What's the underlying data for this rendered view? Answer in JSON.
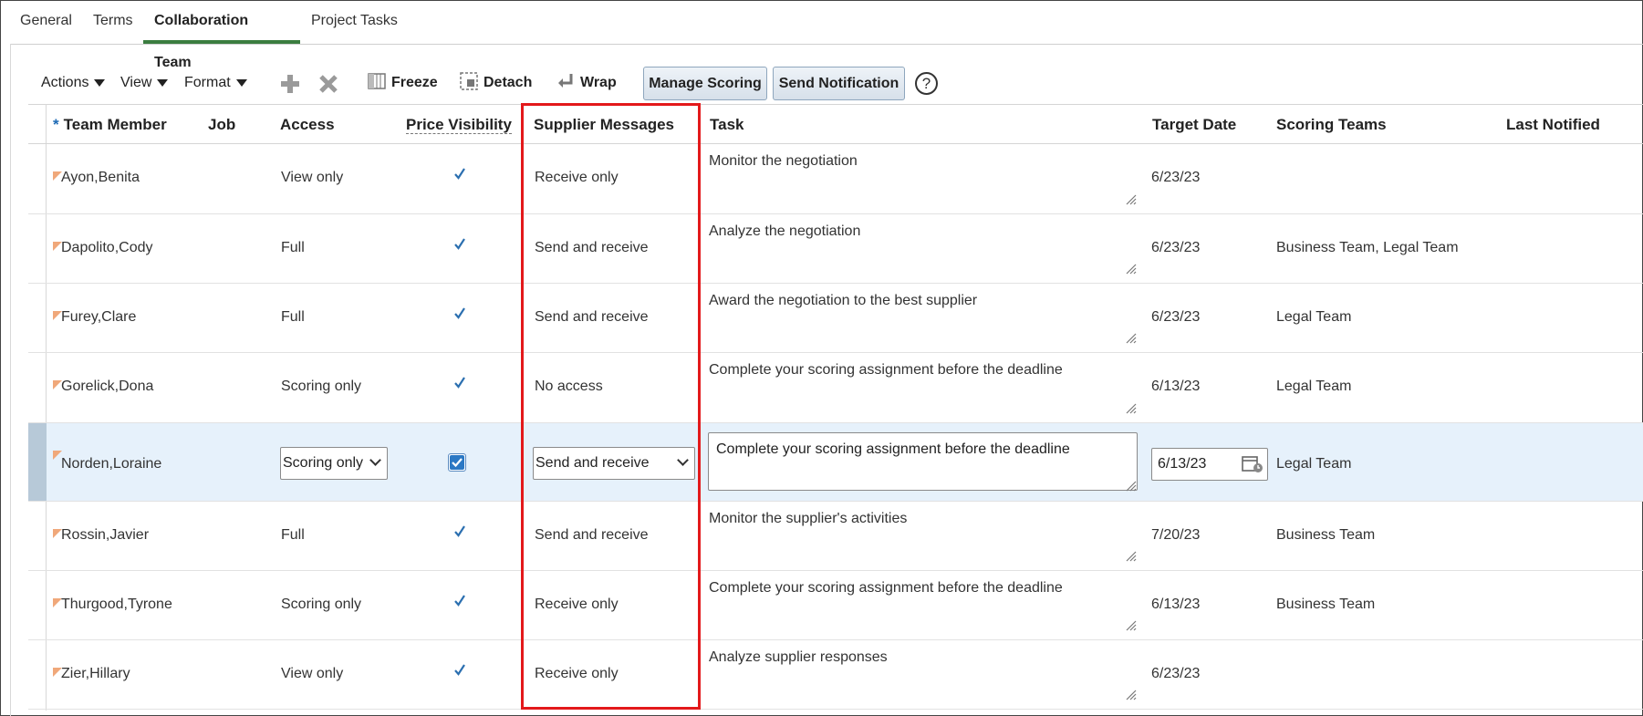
{
  "tabs": [
    {
      "label": "General"
    },
    {
      "label": "Terms"
    },
    {
      "label": "Collaboration Team"
    },
    {
      "label": "Project Tasks"
    }
  ],
  "toolbar": {
    "actions": "Actions",
    "view": "View",
    "format": "Format",
    "freeze": "Freeze",
    "detach": "Detach",
    "wrap": "Wrap",
    "manage_scoring": "Manage Scoring",
    "send_notification": "Send Notification",
    "help": "?"
  },
  "columns": {
    "required_marker": "*",
    "team_member": "Team Member",
    "job": "Job",
    "access": "Access",
    "price_visibility": "Price Visibility",
    "supplier_messages": "Supplier Messages",
    "task": "Task",
    "target_date": "Target Date",
    "scoring_teams": "Scoring Teams",
    "last_notified": "Last Notified"
  },
  "rows": [
    {
      "member": "Ayon,Benita",
      "access": "View only",
      "price_visible": true,
      "messages": "Receive only",
      "task": "Monitor the negotiation",
      "target_date": "6/23/23",
      "scoring_teams": ""
    },
    {
      "member": "Dapolito,Cody",
      "access": "Full",
      "price_visible": true,
      "messages": "Send and receive",
      "task": "Analyze the negotiation",
      "target_date": "6/23/23",
      "scoring_teams": "Business Team, Legal Team"
    },
    {
      "member": "Furey,Clare",
      "access": "Full",
      "price_visible": true,
      "messages": "Send and receive",
      "task": "Award the negotiation to the best supplier",
      "target_date": "6/23/23",
      "scoring_teams": "Legal Team"
    },
    {
      "member": "Gorelick,Dona",
      "access": "Scoring only",
      "price_visible": true,
      "messages": "No access",
      "task": "Complete your scoring assignment before the deadline",
      "target_date": "6/13/23",
      "scoring_teams": "Legal Team"
    },
    {
      "member": "Norden,Loraine",
      "access": "Scoring only",
      "price_visible": true,
      "messages": "Send and receive",
      "task": "Complete your scoring assignment before the deadline",
      "target_date": "6/13/23",
      "scoring_teams": "Legal Team",
      "selected": true
    },
    {
      "member": "Rossin,Javier",
      "access": "Full",
      "price_visible": true,
      "messages": "Send and receive",
      "task": "Monitor the supplier's activities",
      "target_date": "7/20/23",
      "scoring_teams": "Business Team"
    },
    {
      "member": "Thurgood,Tyrone",
      "access": "Scoring only",
      "price_visible": true,
      "messages": "Receive only",
      "task": "Complete your scoring assignment before the deadline",
      "target_date": "6/13/23",
      "scoring_teams": "Business Team"
    },
    {
      "member": "Zier,Hillary",
      "access": "View only",
      "price_visible": true,
      "messages": "Receive only",
      "task": "Analyze supplier responses",
      "target_date": "6/23/23",
      "scoring_teams": ""
    }
  ],
  "colors": {
    "active_tab_underline": "#3a7d3f",
    "highlight_box": "#e3191b",
    "selected_row": "#e6f1fb",
    "check": "#2b6fb0"
  },
  "icons": {
    "add": "plus-icon",
    "delete": "x-icon",
    "freeze": "freeze-icon",
    "detach": "detach-icon",
    "wrap": "wrap-icon",
    "calendar": "calendar-icon",
    "help": "help-icon"
  }
}
